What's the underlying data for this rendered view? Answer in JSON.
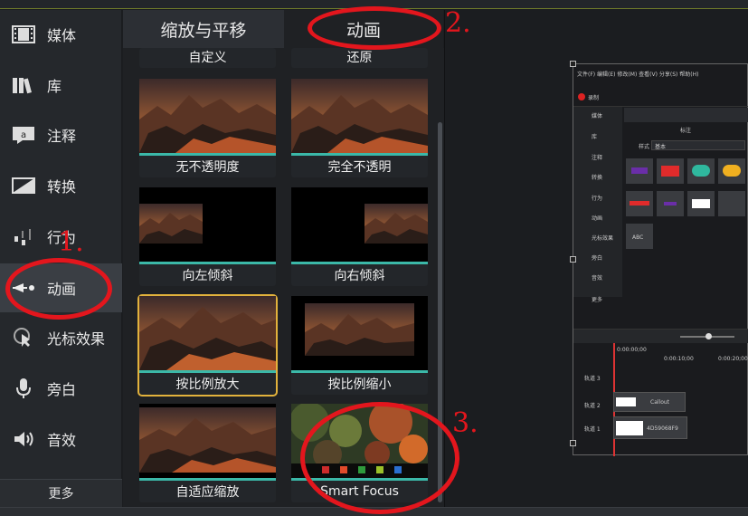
{
  "sidebar": {
    "items": [
      {
        "label": "媒体",
        "icon": "film-icon"
      },
      {
        "label": "库",
        "icon": "library-icon"
      },
      {
        "label": "注释",
        "icon": "annotation-icon"
      },
      {
        "label": "转换",
        "icon": "transition-icon"
      },
      {
        "label": "行为",
        "icon": "behavior-icon"
      },
      {
        "label": "动画",
        "icon": "animation-icon"
      },
      {
        "label": "光标效果",
        "icon": "cursor-effect-icon"
      },
      {
        "label": "旁白",
        "icon": "microphone-icon"
      },
      {
        "label": "音效",
        "icon": "speaker-icon"
      }
    ],
    "more_label": "更多"
  },
  "tabs": {
    "zoom_pan": "缩放与平移",
    "animation": "动画"
  },
  "presets": [
    {
      "label": "自定义"
    },
    {
      "label": "还原"
    },
    {
      "label": "无不透明度"
    },
    {
      "label": "完全不透明"
    },
    {
      "label": "向左倾斜"
    },
    {
      "label": "向右倾斜"
    },
    {
      "label": "按比例放大"
    },
    {
      "label": "按比例缩小"
    },
    {
      "label": "自适应缩放"
    },
    {
      "label": "Smart Focus"
    }
  ],
  "annotations": {
    "n1": "1.",
    "n2": "2.",
    "n3": "3."
  },
  "preview": {
    "menu_text": "文件(F) 编辑(E) 修改(M) 查看(V) 分享(S) 帮助(H)",
    "record_label": "录制",
    "panel_title": "标注",
    "style_label": "样式",
    "style_value": "基本",
    "side_items": [
      "媒体",
      "库",
      "注释",
      "转换",
      "行为",
      "动画",
      "光标效果",
      "旁白",
      "音效"
    ],
    "more_label": "更多",
    "timecodes": [
      "0:00:00;00",
      "0:00:10;00",
      "0:00:20;00"
    ],
    "tracks": [
      {
        "name": "轨道 3",
        "clip": ""
      },
      {
        "name": "轨道 2",
        "clip": "Callout"
      },
      {
        "name": "轨道 1",
        "clip": "4D59068F9"
      }
    ],
    "abc": "ABC"
  },
  "colors": {
    "accent_teal": "#3bb8a8",
    "selected_outline": "#e2b23c",
    "annotation_red": "#e3161d"
  }
}
